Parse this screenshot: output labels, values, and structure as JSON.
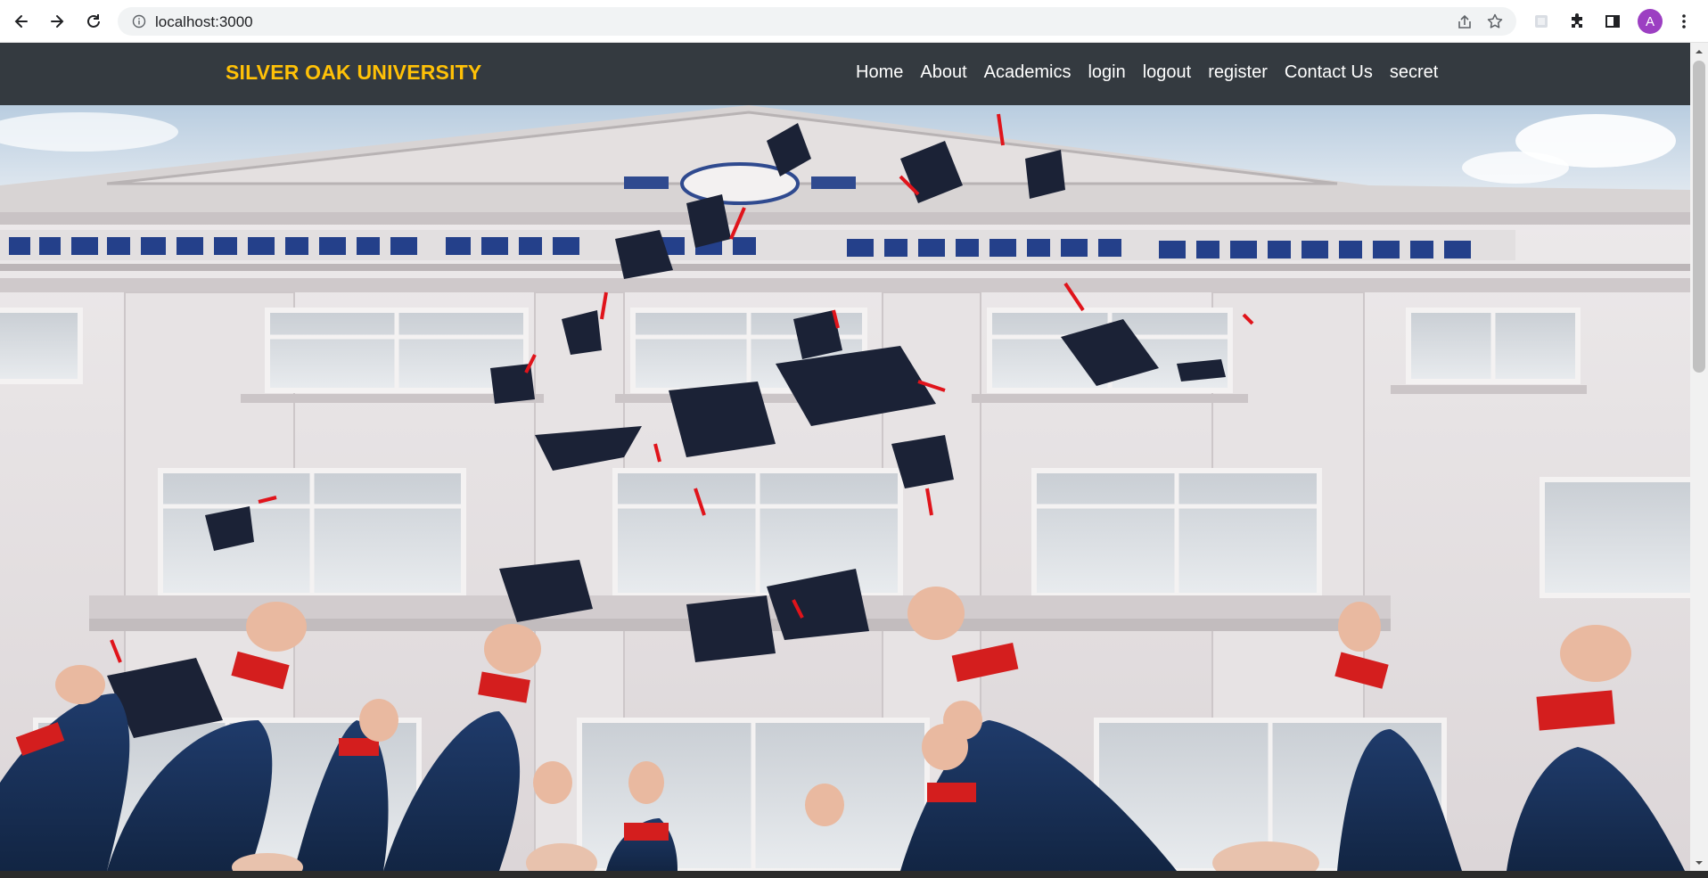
{
  "browser": {
    "url": "localhost:3000",
    "profile_initial": "A",
    "icons": [
      "back-icon",
      "forward-icon",
      "reload-icon",
      "info-icon",
      "share-icon",
      "star-icon",
      "extension-icon",
      "puzzle-icon",
      "side-panel-icon",
      "menu-icon"
    ]
  },
  "site": {
    "brand": "SILVER OAK UNIVERSITY",
    "nav": [
      {
        "label": "Home"
      },
      {
        "label": "About"
      },
      {
        "label": "Academics"
      },
      {
        "label": "login"
      },
      {
        "label": "logout"
      },
      {
        "label": "register"
      },
      {
        "label": "Contact Us"
      },
      {
        "label": "secret"
      }
    ]
  },
  "colors": {
    "navbar_bg": "#343a40",
    "brand": "#ffc107",
    "nav_text": "#ffffff",
    "avatar_bg": "#9c3fc2"
  }
}
